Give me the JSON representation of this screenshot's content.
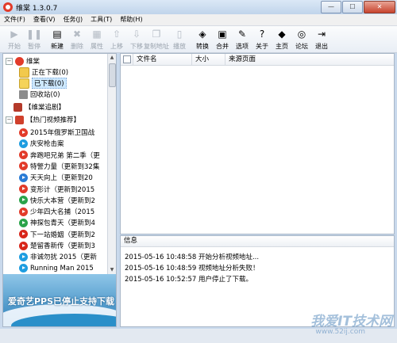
{
  "window": {
    "title": "维棠 1.3.0.7",
    "min_label": "—",
    "max_label": "☐",
    "close_label": "✕"
  },
  "menu": [
    "文件(F)",
    "查看(V)",
    "任务(J)",
    "工具(T)",
    "帮助(H)"
  ],
  "toolbar": [
    {
      "label": "开始",
      "icon": "play-icon",
      "glyph": "▶",
      "enabled": false
    },
    {
      "label": "暂停",
      "icon": "pause-icon",
      "glyph": "❚❚",
      "enabled": false
    },
    {
      "label": "新建",
      "icon": "new-icon",
      "glyph": "▤",
      "enabled": true
    },
    {
      "label": "删除",
      "icon": "delete-icon",
      "glyph": "✖",
      "enabled": false
    },
    {
      "label": "属性",
      "icon": "properties-icon",
      "glyph": "▦",
      "enabled": false
    },
    {
      "label": "上移",
      "icon": "move-up-icon",
      "glyph": "⇧",
      "enabled": false
    },
    {
      "label": "下移",
      "icon": "move-down-icon",
      "glyph": "⇩",
      "enabled": false
    },
    {
      "label": "复制地址",
      "icon": "copy-icon",
      "glyph": "❐",
      "enabled": false
    },
    {
      "label": "播放",
      "icon": "player-icon",
      "glyph": "▯",
      "enabled": false
    },
    {
      "label": "转换",
      "icon": "convert-icon",
      "glyph": "◈",
      "enabled": true
    },
    {
      "label": "合并",
      "icon": "merge-icon",
      "glyph": "▣",
      "enabled": true
    },
    {
      "label": "选项",
      "icon": "options-icon",
      "glyph": "✎",
      "enabled": true
    },
    {
      "label": "关于",
      "icon": "about-icon",
      "glyph": "?",
      "enabled": true
    },
    {
      "label": "主页",
      "icon": "home-icon",
      "glyph": "◆",
      "enabled": true
    },
    {
      "label": "论坛",
      "icon": "forum-icon",
      "glyph": "◎",
      "enabled": true
    },
    {
      "label": "退出",
      "icon": "exit-icon",
      "glyph": "⇥",
      "enabled": true
    }
  ],
  "tree": {
    "root": "维棠",
    "root_children": [
      "正在下载(0)",
      "已下载(0)",
      "回收站(0)"
    ],
    "tracker": "【维棠追剧】",
    "hot": "【热门视频推荐】",
    "hot_items": [
      "2015年俄罗斯卫国战",
      "庆安枪击案",
      "奔跑吧兄弟 第二季（更",
      "特警力量（更新到32集",
      "天天向上（更新到20",
      "变形计（更新到2015",
      "快乐大本营（更新到2",
      "少年四大名捕（2015",
      "神探包青天（更新到4",
      "下一站婚姻（更新到2",
      "楚留香新传（更新到3",
      "非诚勿扰 2015（更新",
      "Running Man 2015"
    ]
  },
  "banner_text": "爱奇艺PPS已停止支持下载",
  "table": {
    "columns": [
      "文件名",
      "大小",
      "来源页面"
    ]
  },
  "info": {
    "header": "信息",
    "lines": [
      "2015-05-16 10:48:58 开始分析视频地址...",
      "2015-05-16 10:48:59 视频地址分析失败！",
      "2015-05-16 10:52:57 用户停止了下载。"
    ]
  },
  "watermark": {
    "text": "我爱IT技术网",
    "url": "www.52ij.com"
  },
  "colors": {
    "hot_item_icons": [
      "#e23b2a",
      "#1e9de0",
      "#e23b2a",
      "#e23b2a",
      "#2a7bd5",
      "#e23b2a",
      "#2aa34a",
      "#e23b2a",
      "#2aa34a",
      "#d8261a",
      "#d8261a",
      "#1e9de0",
      "#1e9de0"
    ]
  }
}
